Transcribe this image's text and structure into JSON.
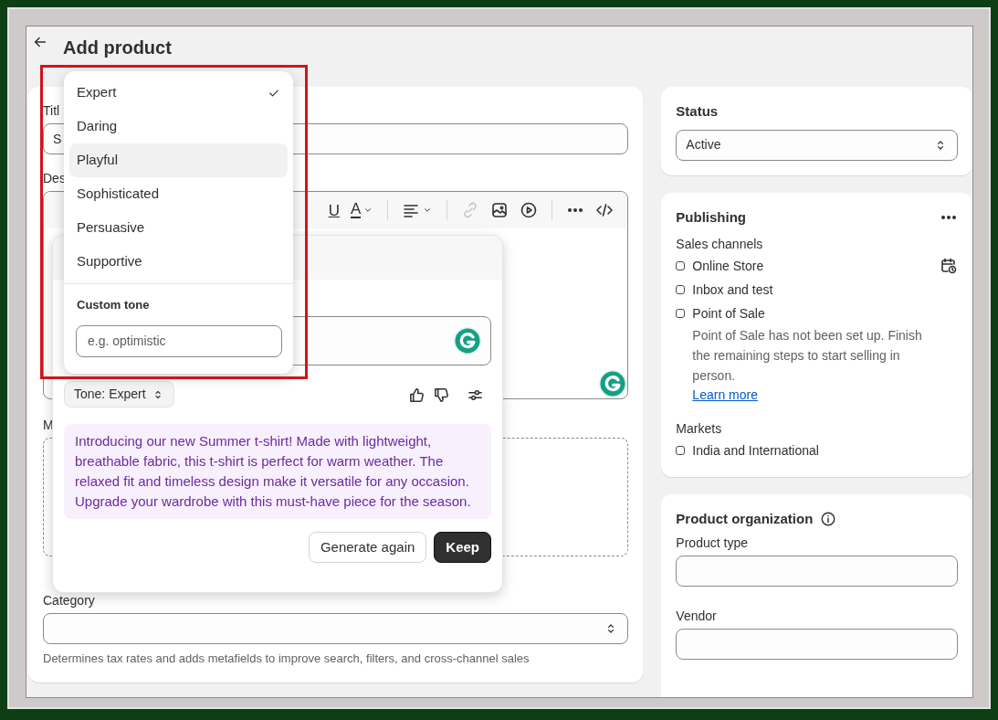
{
  "header": {
    "title": "Add product"
  },
  "product_card": {
    "title_label": "Titl",
    "title_value": "S",
    "description_label": "Des",
    "toolbar_groups": [
      [
        {
          "kind": "underline",
          "label": "U"
        },
        {
          "kind": "color",
          "label": "A"
        }
      ],
      [
        {
          "kind": "align"
        }
      ],
      [
        {
          "kind": "link",
          "disabled": true
        },
        {
          "kind": "image",
          "disabled": false
        },
        {
          "kind": "video",
          "disabled": false
        }
      ],
      [
        {
          "kind": "more"
        },
        {
          "kind": "code"
        }
      ]
    ],
    "media_label": "M",
    "category_label": "Category",
    "category_help": "Determines tax rates and adds metafields to improve search, filters, and cross-channel sales"
  },
  "ai_popup": {
    "tone_button": "Tone: Expert",
    "generated_text": "Introducing our new Summer t-shirt! Made with lightweight, breathable fabric, this t-shirt is perfect for warm weather. The relaxed fit and timeless design make it versatile for any occasion. Upgrade your wardrobe with this must-have piece for the season.",
    "buttons": [
      {
        "label": "Generate again",
        "kind": "secondary"
      },
      {
        "label": "Keep",
        "kind": "primary"
      }
    ]
  },
  "tone_menu": {
    "items": [
      {
        "label": "Expert",
        "selected": true,
        "highlighted": false
      },
      {
        "label": "Daring",
        "selected": false,
        "highlighted": false
      },
      {
        "label": "Playful",
        "selected": false,
        "highlighted": true
      },
      {
        "label": "Sophisticated",
        "selected": false,
        "highlighted": false
      },
      {
        "label": "Persuasive",
        "selected": false,
        "highlighted": false
      },
      {
        "label": "Supportive",
        "selected": false,
        "highlighted": false
      }
    ],
    "custom_tone_label": "Custom tone",
    "custom_tone_placeholder": "e.g. optimistic"
  },
  "status_card": {
    "title": "Status",
    "value": "Active"
  },
  "publishing_card": {
    "title": "Publishing",
    "sales_channels_label": "Sales channels",
    "channels": [
      {
        "name": "Online Store",
        "checked": false,
        "schedule": true
      },
      {
        "name": "Inbox and test",
        "checked": false
      },
      {
        "name": "Point of Sale",
        "checked": false,
        "note": "Point of Sale has not been set up. Finish the remaining steps to start selling in person.",
        "link": "Learn more"
      }
    ],
    "markets_label": "Markets",
    "markets": [
      {
        "name": "India and International",
        "checked": false
      }
    ]
  },
  "organization_card": {
    "title": "Product organization",
    "fields": [
      {
        "label": "Product type"
      },
      {
        "label": "Vendor"
      }
    ]
  }
}
